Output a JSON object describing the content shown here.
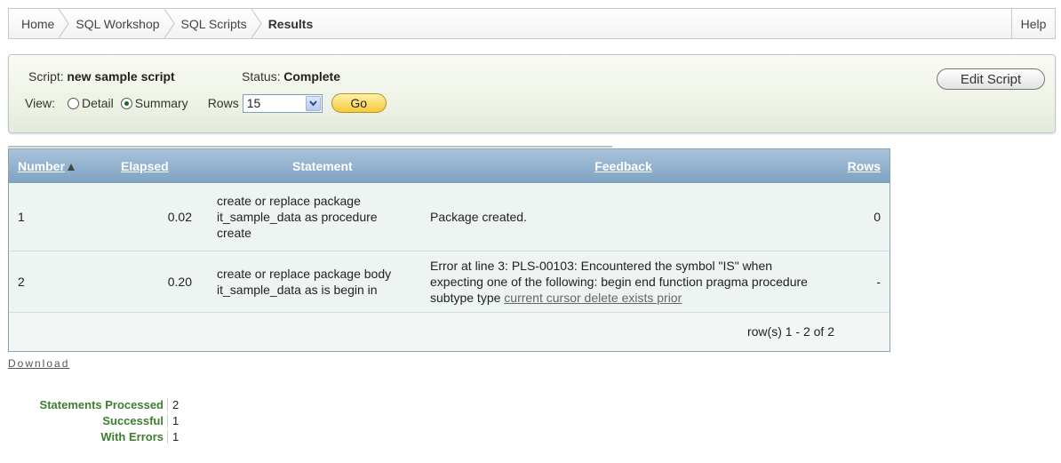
{
  "breadcrumb": {
    "items": [
      "Home",
      "SQL Workshop",
      "SQL Scripts"
    ],
    "current": "Results"
  },
  "help_label": "Help",
  "panel": {
    "script_label": "Script:",
    "script_value": "new sample script",
    "status_label": "Status:",
    "status_value": "Complete",
    "view_label": "View:",
    "view_options": [
      "Detail",
      "Summary"
    ],
    "view_selected": "Summary",
    "rows_label": "Rows",
    "rows_value": "15",
    "go_label": "Go",
    "edit_script_label": "Edit Script"
  },
  "report": {
    "columns": [
      "Number",
      "Elapsed",
      "Statement",
      "Feedback",
      "Rows"
    ],
    "sorted_column": "Number",
    "rows": [
      {
        "number": "1",
        "elapsed": "0.02",
        "statement": "create or replace package it_sample_data as procedure create",
        "feedback": "Package created.",
        "feedback_link": "",
        "rows": "0"
      },
      {
        "number": "2",
        "elapsed": "0.20",
        "statement": "create or replace package body it_sample_data as is begin in",
        "feedback": "Error at line 3: PLS-00103: Encountered the symbol \"IS\" when expecting one of the following: begin end function pragma procedure subtype type ",
        "feedback_link": "current cursor delete exists prior",
        "rows": "-"
      }
    ],
    "pagination": "row(s) 1 - 2 of 2"
  },
  "download_label": "Download",
  "stats": [
    {
      "label": "Statements Processed",
      "value": "2"
    },
    {
      "label": "Successful",
      "value": "1"
    },
    {
      "label": "With Errors",
      "value": "1"
    }
  ],
  "colors": {
    "header_blue": "#8fb0cc",
    "stat_green": "#3c7f2e",
    "go_yellow": "#f7c93b"
  }
}
